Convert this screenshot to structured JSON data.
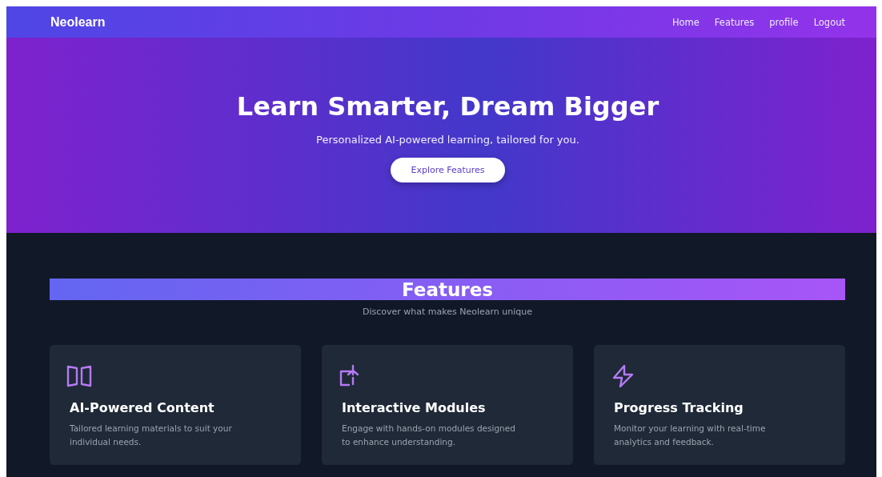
{
  "navbar": {
    "logo": "Neolearn",
    "links": [
      "Home",
      "Features",
      "profile",
      "Logout"
    ]
  },
  "hero": {
    "title": "Learn Smarter, Dream Bigger",
    "subtitle": "Personalized AI-powered learning, tailored for you.",
    "button": "Explore Features"
  },
  "features": {
    "title": "Features",
    "subtitle": "Discover what makes Neolearn unique",
    "cards": [
      {
        "title": "AI-Powered Content",
        "text": "Tailored learning materials to suit your individual needs."
      },
      {
        "title": "Interactive Modules",
        "text": "Engage with hands-on modules designed to enhance understanding."
      },
      {
        "title": "Progress Tracking",
        "text": "Monitor your learning with real-time analytics and feedback."
      }
    ]
  }
}
